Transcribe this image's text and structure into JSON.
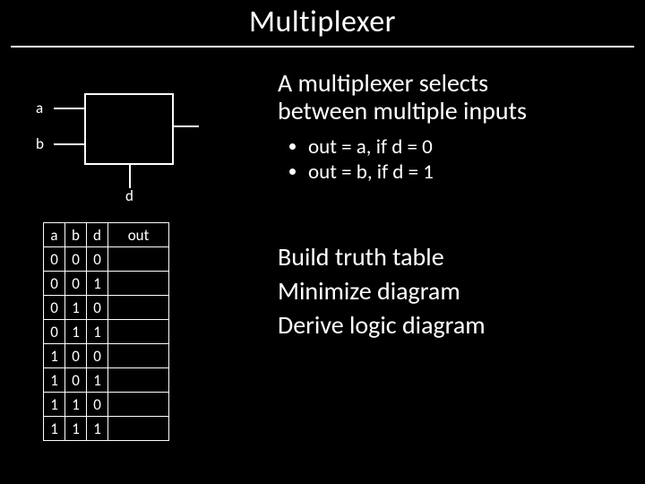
{
  "title": "Multiplexer",
  "diagram": {
    "a": "a",
    "b": "b",
    "d": "d"
  },
  "heading_l1": "A multiplexer selects",
  "heading_l2": "between multiple inputs",
  "bullet1": "out = a, if d = 0",
  "bullet2": "out = b, if d = 1",
  "step1": "Build truth table",
  "step2": "Minimize diagram",
  "step3": "Derive logic diagram",
  "truth": {
    "headers": {
      "a": "a",
      "b": "b",
      "d": "d",
      "out": "out"
    },
    "rows": [
      {
        "a": "0",
        "b": "0",
        "d": "0",
        "out": ""
      },
      {
        "a": "0",
        "b": "0",
        "d": "1",
        "out": ""
      },
      {
        "a": "0",
        "b": "1",
        "d": "0",
        "out": ""
      },
      {
        "a": "0",
        "b": "1",
        "d": "1",
        "out": ""
      },
      {
        "a": "1",
        "b": "0",
        "d": "0",
        "out": ""
      },
      {
        "a": "1",
        "b": "0",
        "d": "1",
        "out": ""
      },
      {
        "a": "1",
        "b": "1",
        "d": "0",
        "out": ""
      },
      {
        "a": "1",
        "b": "1",
        "d": "1",
        "out": ""
      }
    ]
  }
}
